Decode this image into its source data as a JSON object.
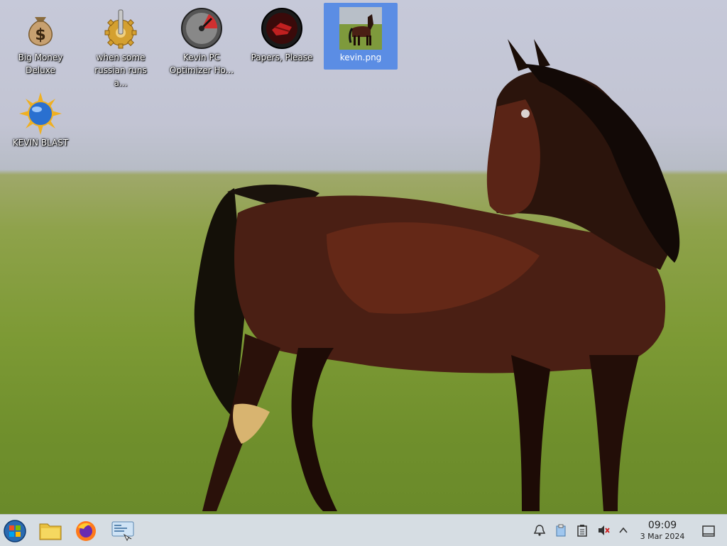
{
  "desktop_icons": [
    {
      "label": "Big Money Deluxe",
      "icon": "money-bag-icon",
      "selected": false
    },
    {
      "label": "when some russian runs a...",
      "icon": "gear-icon",
      "selected": false
    },
    {
      "label": "Kevin PC Optimizer Ho...",
      "icon": "gauge-icon",
      "selected": false
    },
    {
      "label": "Papers, Please",
      "icon": "papers-please-icon",
      "selected": false
    },
    {
      "label": "kevin.png",
      "icon": "horse-image-icon",
      "selected": true
    },
    {
      "label": "KEVIN BLAST",
      "icon": "sun-globe-icon",
      "selected": false
    }
  ],
  "taskbar": {
    "launcher": "start-menu-icon",
    "pinned": [
      "file-manager-icon",
      "firefox-icon",
      "system-settings-icon"
    ],
    "tray": [
      "notifications-icon",
      "clipboard-icon",
      "task-icon",
      "volume-muted-icon",
      "expand-tray-icon"
    ],
    "clock": {
      "time": "09:09",
      "date": "3 Mar 2024"
    }
  }
}
